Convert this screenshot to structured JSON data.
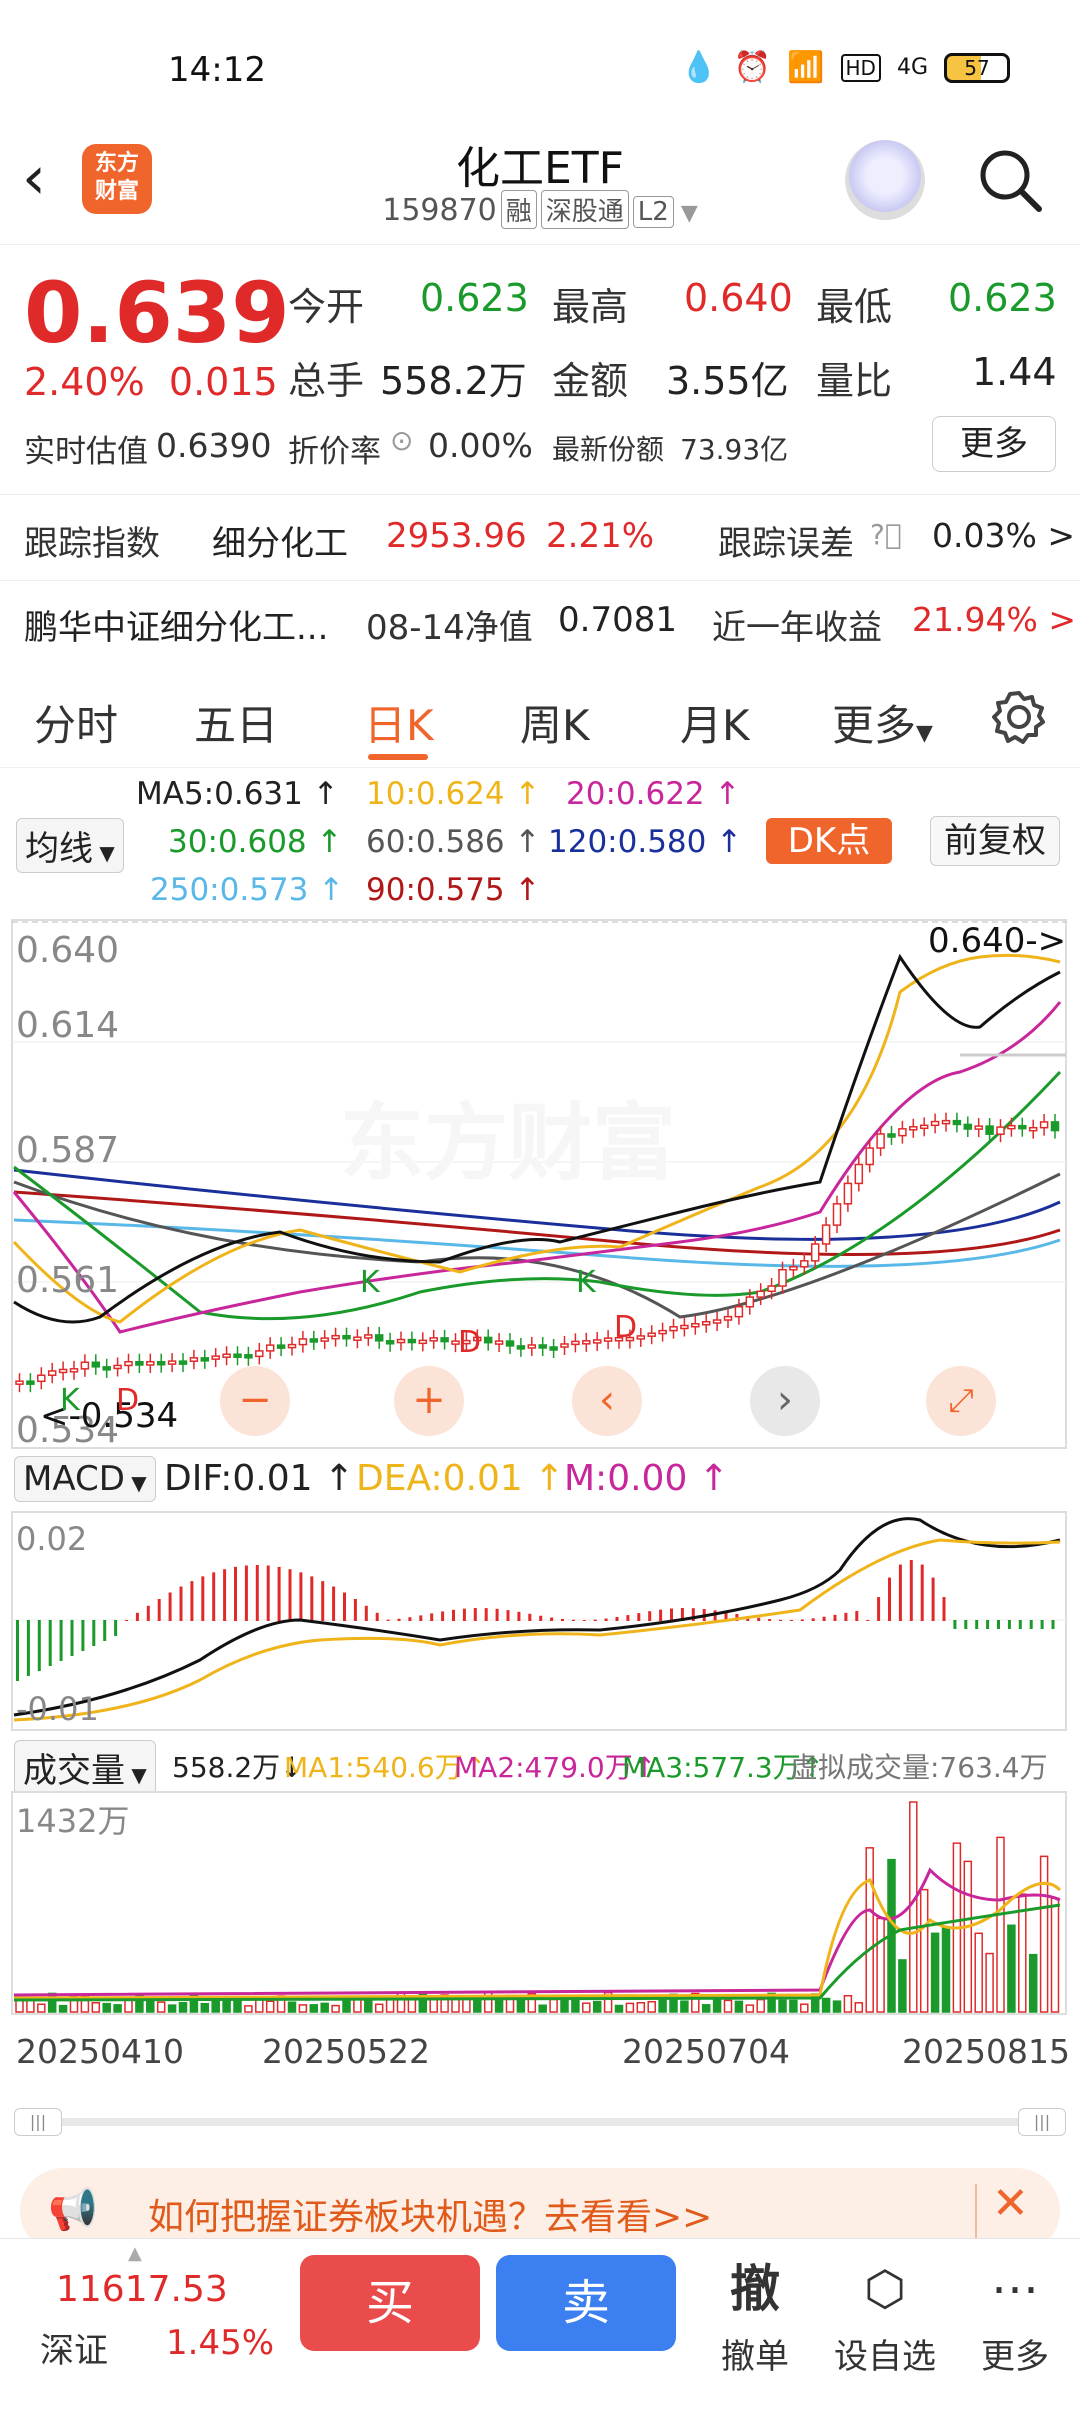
{
  "status_bar": {
    "time": "14:12",
    "battery": "57",
    "network": "4G"
  },
  "nav": {
    "title": "化工ETF",
    "code": "159870",
    "tags": [
      "融",
      "深股通",
      "L2"
    ],
    "logo_text": "东方\n财富"
  },
  "quote": {
    "price": "0.639",
    "change_pct": "2.40%",
    "change": "0.015",
    "open_label": "今开",
    "open": "0.623",
    "high_label": "最高",
    "high": "0.640",
    "low_label": "最低",
    "low": "0.623",
    "volume_label": "总手",
    "volume": "558.2万",
    "amount_label": "金额",
    "amount": "3.55亿",
    "ratio_label": "量比",
    "ratio": "1.44",
    "est_label": "实时估值",
    "est": "0.6390",
    "premium_label": "折价率",
    "premium": "0.00%",
    "shares_label": "最新份额",
    "shares": "73.93亿",
    "more": "更多"
  },
  "tracking": {
    "index_label": "跟踪指数",
    "index_name": "细分化工",
    "index_value": "2953.96",
    "index_pct": "2.21%",
    "error_label": "跟踪误差",
    "error_value": "0.03% >"
  },
  "fund": {
    "name": "鹏华中证细分化工...",
    "nav_label": "08-14净值",
    "nav": "0.7081",
    "yearly_label": "近一年收益",
    "yearly": "21.94% >"
  },
  "tabs": [
    "分时",
    "五日",
    "日K",
    "周K",
    "月K",
    "更多"
  ],
  "ma": {
    "dropdown": "均线",
    "ma5": "MA5:0.631",
    "ma10": "10:0.624",
    "ma20": "20:0.622",
    "ma30": "30:0.608",
    "ma60": "60:0.586",
    "ma120": "120:0.580",
    "ma250": "250:0.573",
    "ma90": "90:0.575",
    "dk": "DK点",
    "adjust": "前复权"
  },
  "kchart": {
    "y_labels": [
      "0.640",
      "0.614",
      "0.587",
      "0.561",
      "0.534"
    ],
    "high_marker": "0.640->",
    "low_marker": "<-0.534",
    "signals": [
      "K",
      "D",
      "K",
      "D",
      "D",
      "K"
    ]
  },
  "macd": {
    "dropdown": "MACD",
    "dif": "DIF:0.01",
    "dea": "DEA:0.01",
    "m": "M:0.00",
    "y_top": "0.02",
    "y_bottom": "-0.01"
  },
  "volume": {
    "dropdown": "成交量",
    "vol": "558.2万",
    "ma1": "MA1:540.6万",
    "ma2": "MA2:479.0万",
    "ma3": "MA3:577.3万",
    "virtual": "虚拟成交量:763.4万",
    "y_top": "1432万"
  },
  "x_dates": [
    "20250410",
    "20250522",
    "20250704",
    "20250815"
  ],
  "banner": {
    "text": "如何把握证券板块机遇？去看看>>"
  },
  "bottom": {
    "index_value": "11617.53",
    "index_name": "深证",
    "index_pct": "1.45%",
    "buy": "买",
    "sell": "卖",
    "cancel_icon": "撤",
    "cancel": "撤单",
    "watch": "设自选",
    "more": "更多"
  },
  "colors": {
    "up": "#e02a2a",
    "down": "#1a9a2a",
    "accent": "#f0652b"
  }
}
